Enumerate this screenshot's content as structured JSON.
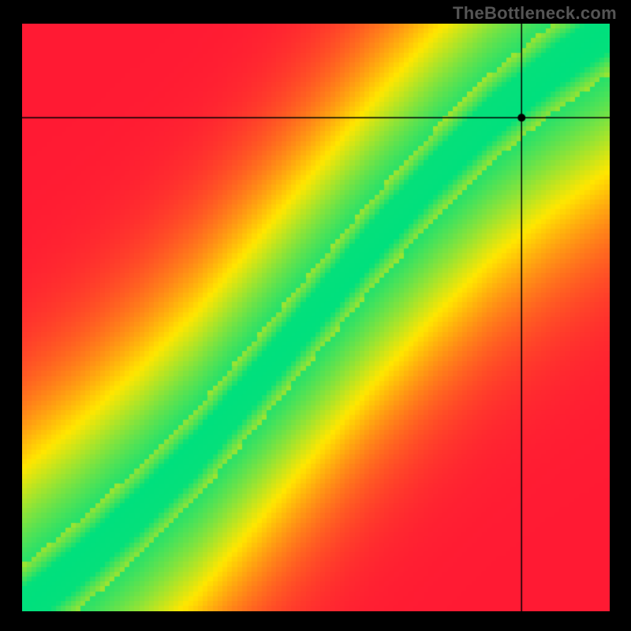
{
  "attribution": "TheBottleneck.com",
  "chart_data": {
    "type": "heatmap",
    "title": "",
    "xlabel": "",
    "ylabel": "",
    "xlim": [
      0,
      1
    ],
    "ylim": [
      0,
      1
    ],
    "grid": false,
    "legend": false,
    "color_stops": {
      "low": "#ff1a33",
      "mid": "#ffe600",
      "high": "#00e07d"
    },
    "ridge": {
      "description": "Green optimal band follows a monotonically increasing curve from lower-left to upper-right; slight S-bend near x≈0.25.",
      "points": [
        {
          "x": 0.0,
          "y": 0.0
        },
        {
          "x": 0.1,
          "y": 0.08
        },
        {
          "x": 0.2,
          "y": 0.17
        },
        {
          "x": 0.3,
          "y": 0.27
        },
        {
          "x": 0.4,
          "y": 0.39
        },
        {
          "x": 0.5,
          "y": 0.51
        },
        {
          "x": 0.6,
          "y": 0.63
        },
        {
          "x": 0.7,
          "y": 0.74
        },
        {
          "x": 0.8,
          "y": 0.84
        },
        {
          "x": 0.9,
          "y": 0.92
        },
        {
          "x": 1.0,
          "y": 0.99
        }
      ],
      "band_halfwidth_fraction": 0.035
    },
    "crosshair": {
      "x": 0.85,
      "y": 0.84,
      "marker": "dot"
    },
    "pixel_grid": 120
  }
}
